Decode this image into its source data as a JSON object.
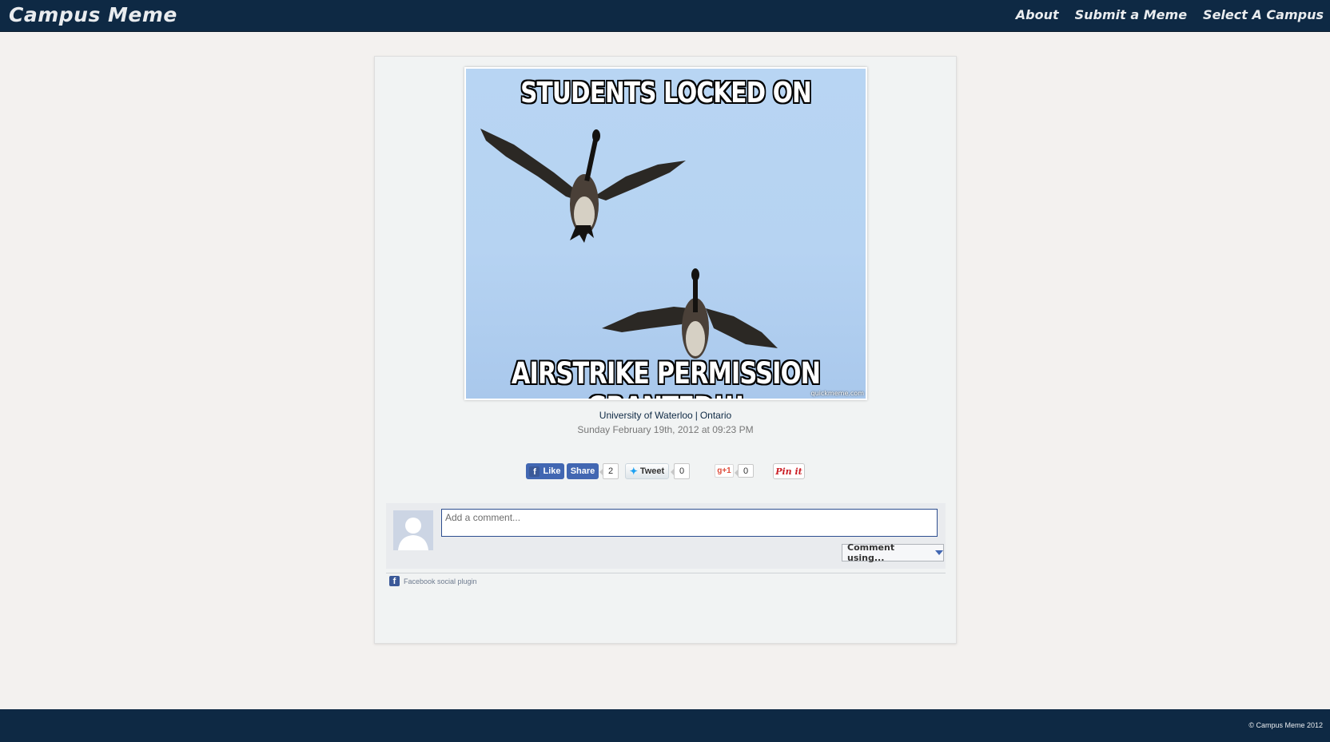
{
  "header": {
    "brand": "Campus Meme",
    "nav": [
      "About",
      "Submit a Meme",
      "Select A Campus"
    ]
  },
  "meme": {
    "top_text": "STUDENTS LOCKED ON",
    "bottom_text": "AIRSTRIKE PERMISSION GRANTED!!!",
    "watermark": "quickmeme.com"
  },
  "post": {
    "university": "University of Waterloo",
    "province": "Ontario",
    "separator": "|",
    "date": "Sunday February 19th, 2012 at 09:23 PM"
  },
  "social": {
    "like_label": "Like",
    "share_label": "Share",
    "share_count": "2",
    "tweet_label": "Tweet",
    "tweet_count": "0",
    "gplus_label": "g+1",
    "gplus_count": "0",
    "pinit_label": "Pin it"
  },
  "comments": {
    "placeholder": "Add a comment...",
    "comment_using": "Comment using...",
    "plugin_label": "Facebook social plugin"
  },
  "footer": {
    "copyright": "© Campus Meme 2012"
  },
  "colors": {
    "nav_bg": "#0e2944",
    "page_bg": "#f3f1ef",
    "facebook_blue": "#4267b2"
  }
}
